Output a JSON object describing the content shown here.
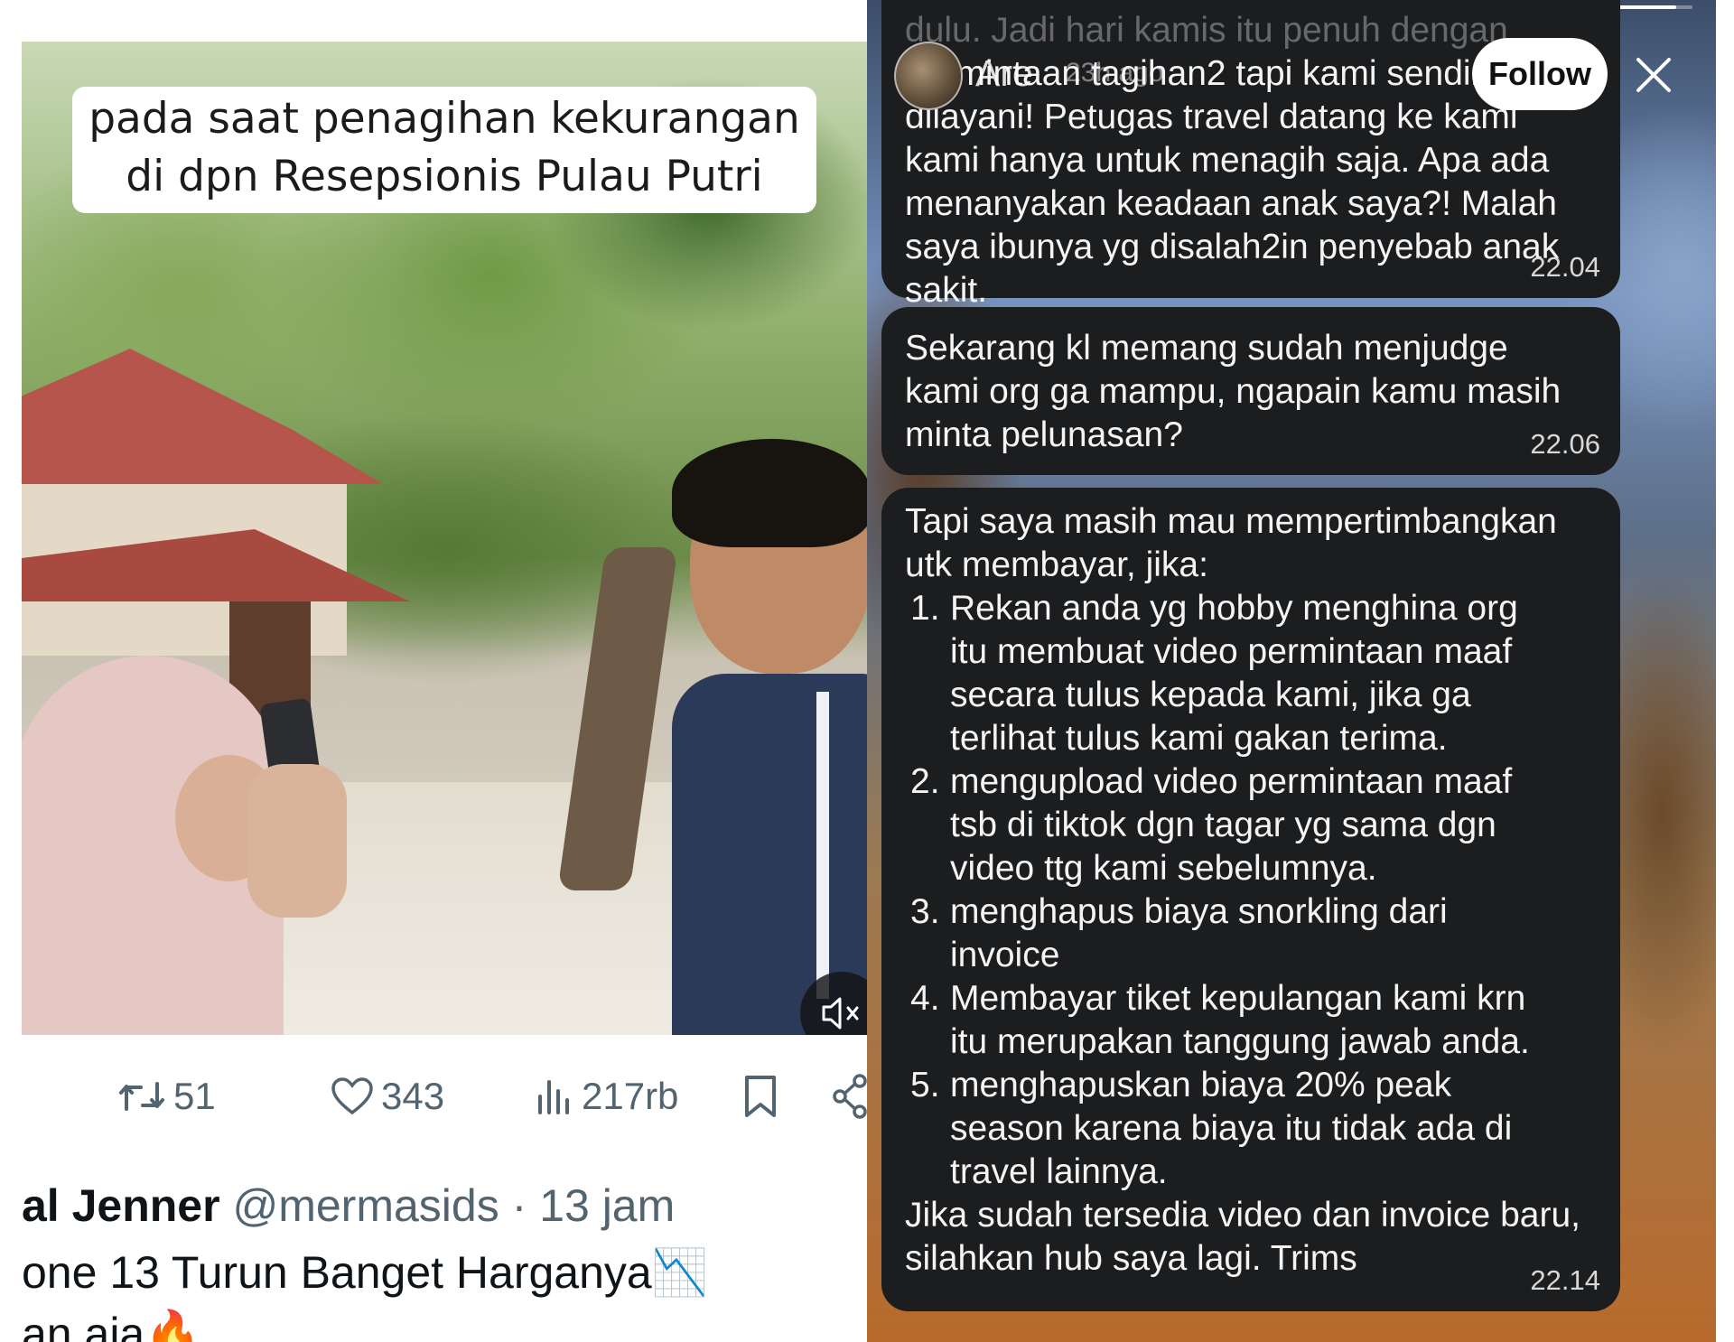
{
  "left": {
    "caption_lines": [
      "pada saat penagihan kekurangan",
      "di dpn Resepsionis Pulau Putri"
    ],
    "actions": {
      "retweet_count": "51",
      "like_count": "343",
      "view_count": "217rb"
    },
    "next_tweet": {
      "name": "al Jenner",
      "handle": "@mermasids",
      "separator": "·",
      "time": "13 jam",
      "line1": "one 13 Turun Banget Harganya📉",
      "line2": "an aja🔥"
    },
    "icons": [
      "retweet-icon",
      "heart-icon",
      "views-icon",
      "bookmark-icon",
      "share-icon",
      "mute-icon"
    ]
  },
  "right": {
    "progress": 0.98,
    "user": {
      "name": "Are",
      "age": "23h ago"
    },
    "follow_label": "Follow",
    "bubbles": [
      {
        "lines": [
          "dulu. Jadi hari kamis itu penuh dengan",
          "permintaan tagihan2 tapi kami sendiri ga",
          "dilayani! Petugas travel datang ke kami",
          "kami hanya untuk menagih saja. Apa ada",
          "menanyakan keadaan anak saya?! Malah",
          "saya ibunya yg disalah2in penyebab anak",
          "sakit."
        ],
        "time": "22.04"
      },
      {
        "lines": [
          "Sekarang kl memang sudah menjudge",
          "kami org ga mampu, ngapain kamu masih",
          "minta pelunasan?"
        ],
        "time": "22.06"
      },
      {
        "intro": [
          "Tapi saya masih mau mempertimbangkan",
          "utk membayar, jika:"
        ],
        "items": [
          {
            "num": "1.",
            "lines": [
              "Rekan anda yg hobby menghina org",
              "itu membuat video permintaan maaf",
              "secara tulus kepada kami, jika ga",
              "terlihat tulus kami gakan terima."
            ]
          },
          {
            "num": "2.",
            "lines": [
              "mengupload video permintaan maaf",
              "tsb di tiktok dgn tagar yg sama dgn",
              "video ttg kami sebelumnya."
            ]
          },
          {
            "num": "3.",
            "lines": [
              "menghapus biaya snorkling dari",
              "invoice"
            ]
          },
          {
            "num": "4.",
            "lines": [
              "Membayar tiket kepulangan kami krn",
              "itu merupakan tanggung jawab anda."
            ]
          },
          {
            "num": "5.",
            "lines": [
              "menghapuskan biaya 20% peak",
              "season karena biaya itu tidak ada di",
              "travel lainnya."
            ]
          }
        ],
        "outro": [
          "Jika sudah tersedia video dan invoice baru,",
          "silahkan hub saya lagi. Trims"
        ],
        "time": "22.14"
      }
    ]
  }
}
